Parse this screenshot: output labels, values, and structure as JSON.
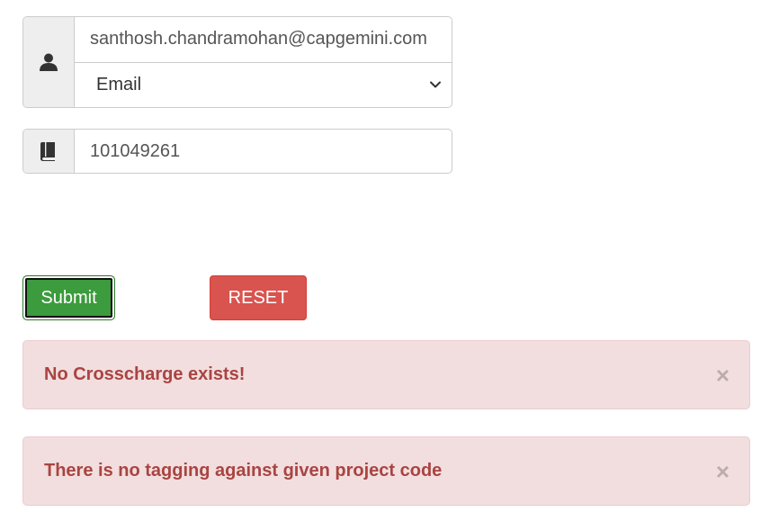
{
  "form": {
    "email_value": "santhosh.chandramohan@capgemini.com",
    "search_type_selected": "Email",
    "project_code_value": "101049261"
  },
  "buttons": {
    "submit_label": "Submit",
    "reset_label": "RESET"
  },
  "alerts": [
    {
      "message": "No Crosscharge exists!",
      "close": "×"
    },
    {
      "message": "There is no tagging against given project code",
      "close": "×"
    }
  ],
  "icons": {
    "user_addon": "user-icon",
    "book_addon": "book-icon",
    "select_arrow": "chevron-down-icon"
  },
  "colors": {
    "submit": "#3c9b3c",
    "reset": "#d9534f",
    "alert_bg": "#f2dede",
    "alert_text": "#a94442"
  }
}
